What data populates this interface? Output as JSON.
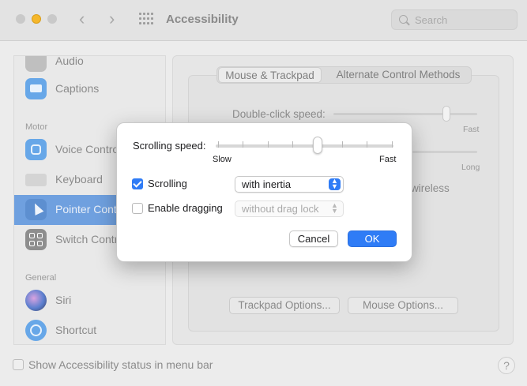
{
  "window": {
    "title": "Accessibility",
    "search_placeholder": "Search"
  },
  "sidebar": {
    "items": [
      {
        "label": "Audio",
        "icon": "audio-icon"
      },
      {
        "label": "Captions",
        "icon": "captions-icon"
      },
      {
        "label": "Voice Control",
        "icon": "voice-control-icon"
      },
      {
        "label": "Keyboard",
        "icon": "keyboard-icon"
      },
      {
        "label": "Pointer Control",
        "icon": "pointer-control-icon",
        "selected": true
      },
      {
        "label": "Switch Control",
        "icon": "switch-control-icon"
      },
      {
        "label": "Siri",
        "icon": "siri-icon"
      },
      {
        "label": "Shortcut",
        "icon": "shortcut-icon"
      }
    ],
    "sections": {
      "motor": "Motor",
      "general": "General"
    }
  },
  "panel": {
    "tabs": [
      "Mouse & Trackpad",
      "Alternate Control Methods"
    ],
    "double_click_label": "Double-click speed:",
    "fast_label": "Fast",
    "long_label": "Long",
    "wireless_fragment": "wireless",
    "trackpad_options": "Trackpad Options...",
    "mouse_options": "Mouse Options..."
  },
  "footer": {
    "status_label": "Show Accessibility status in menu bar",
    "help": "?"
  },
  "dialog": {
    "scrolling_speed_label": "Scrolling speed:",
    "scrolling_speed_level": 0.6,
    "slow_label": "Slow",
    "fast_label": "Fast",
    "scrolling": {
      "label": "Scrolling",
      "checked": true,
      "value": "with inertia"
    },
    "dragging": {
      "label": "Enable dragging",
      "checked": false,
      "value": "without drag lock"
    },
    "cancel_label": "Cancel",
    "ok_label": "OK"
  },
  "colors": {
    "accent": "#2f7cf6",
    "sidebar_selected": "#6fa0df"
  }
}
